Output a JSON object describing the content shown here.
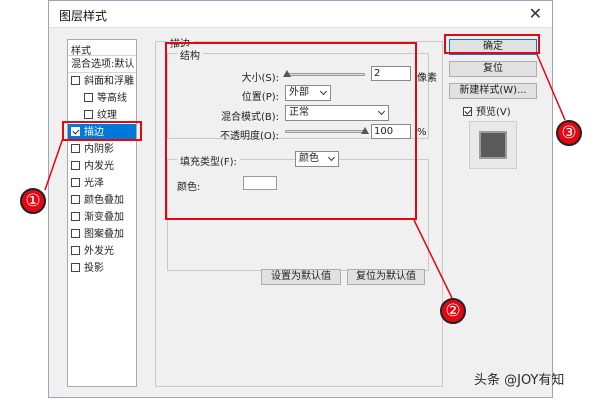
{
  "dialog": {
    "title": "图层样式",
    "close_glyph": "✕"
  },
  "styles_panel": {
    "header": "样式",
    "blend_options": "混合选项:默认",
    "items": [
      {
        "label": "斜面和浮雕",
        "checked": false,
        "selected": false
      },
      {
        "label": "等高线",
        "checked": false,
        "selected": false
      },
      {
        "label": "纹理",
        "checked": false,
        "selected": false
      },
      {
        "label": "描边",
        "checked": true,
        "selected": true
      },
      {
        "label": "内阴影",
        "checked": false,
        "selected": false
      },
      {
        "label": "内发光",
        "checked": false,
        "selected": false
      },
      {
        "label": "光泽",
        "checked": false,
        "selected": false
      },
      {
        "label": "颜色叠加",
        "checked": false,
        "selected": false
      },
      {
        "label": "渐变叠加",
        "checked": false,
        "selected": false
      },
      {
        "label": "图案叠加",
        "checked": false,
        "selected": false
      },
      {
        "label": "外发光",
        "checked": false,
        "selected": false
      },
      {
        "label": "投影",
        "checked": false,
        "selected": false
      }
    ]
  },
  "stroke": {
    "section_title": "描边",
    "structure_title": "结构",
    "size": {
      "label": "大小(S):",
      "value": "2",
      "unit": "像素",
      "slider_level": 0.02
    },
    "position": {
      "label": "位置(P):",
      "value": "外部"
    },
    "blend_mode": {
      "label": "混合模式(B):",
      "value": "正常"
    },
    "opacity": {
      "label": "不透明度(O):",
      "value": "100",
      "unit": "%",
      "slider_level": 1.0
    },
    "fill_type": {
      "label": "填充类型(F):",
      "value": "颜色"
    },
    "color": {
      "label": "颜色:",
      "swatch": "#ffffff"
    },
    "set_default_label": "设置为默认值",
    "reset_default_label": "复位为默认值"
  },
  "actions": {
    "ok_label": "确定",
    "reset_label": "复位",
    "new_style_label": "新建样式(W)...",
    "preview_label": "预览(V)",
    "preview_checked": true
  },
  "annotations": {
    "marker_1": "①",
    "marker_2": "②",
    "marker_3": "③",
    "color": "#e30613"
  },
  "watermark": "头条 @JOY有知"
}
